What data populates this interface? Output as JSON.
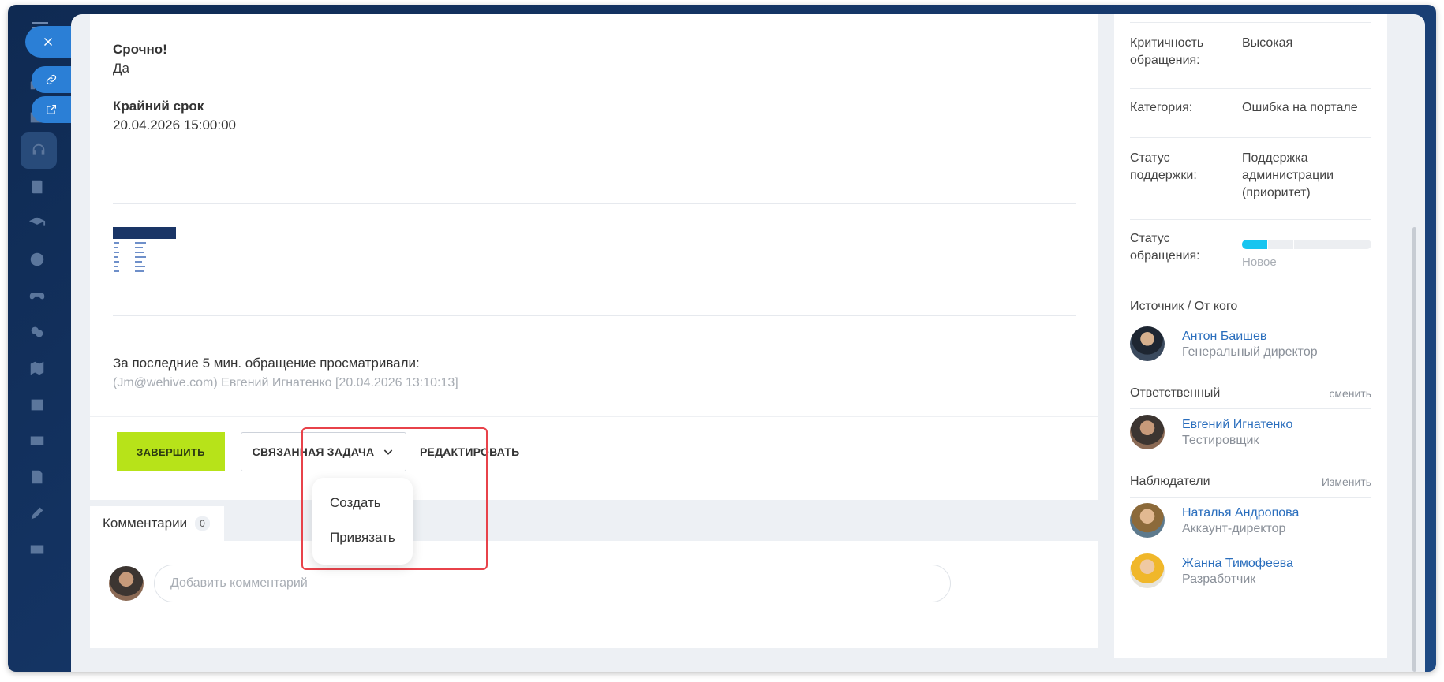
{
  "colors": {
    "accent_blue": "#2b7fd6",
    "finish_green": "#b7e319",
    "highlight_red": "#e8424a",
    "progress_cyan": "#17c5f0",
    "link_blue": "#2a6ebd"
  },
  "rail": {
    "icons": [
      "menu-icon",
      "close-icon",
      "link-icon",
      "external-link-icon",
      "home-icon",
      "support-icon",
      "book-icon",
      "graduation-cap-icon",
      "target-icon",
      "gamepad-icon",
      "chat-icon",
      "map-icon",
      "calendar-icon",
      "card-icon",
      "edit-doc-icon",
      "pen-icon",
      "id-card-icon"
    ]
  },
  "ticket": {
    "urgent_label": "Срочно!",
    "urgent_value": "Да",
    "deadline_label": "Крайний срок",
    "deadline_value": "20.04.2026 15:00:00",
    "viewed_title": "За последние 5 мин. обращение просматривали:",
    "viewed_list": "(Jm@wehive.com) Евгений Игнатенко [20.04.2026 13:10:13]"
  },
  "actions": {
    "finish_label": "ЗАВЕРШИТЬ",
    "related_task_label": "СВЯЗАННАЯ ЗАДАЧА",
    "edit_label": "РЕДАКТИРОВАТЬ",
    "dropdown_items": [
      "Создать",
      "Привязать"
    ]
  },
  "comments": {
    "tab_label": "Комментарии",
    "count": "0",
    "input_placeholder": "Добавить комментарий"
  },
  "sidebar": {
    "criticality_key": "Критичность обращения:",
    "criticality_value": "Высокая",
    "category_key": "Категория:",
    "category_value": "Ошибка на портале",
    "support_status_key": "Статус поддержки:",
    "support_status_value": "Поддержка администрации (приоритет)",
    "ticket_status_key": "Статус обращения:",
    "ticket_status_value": "Новое",
    "ticket_status_progress": 0.2,
    "source_title": "Источник / От кого",
    "source_person": {
      "name": "Антон Баишев",
      "role": "Генеральный директор"
    },
    "responsible_title": "Ответственный",
    "responsible_link": "сменить",
    "responsible_person": {
      "name": "Евгений Игнатенко",
      "role": "Тестировщик"
    },
    "watchers_title": "Наблюдатели",
    "watchers_link": "Изменить",
    "watchers": [
      {
        "name": "Наталья Андропова",
        "role": "Аккаунт-директор"
      },
      {
        "name": "Жанна Тимофеева",
        "role": "Разработчик"
      }
    ]
  }
}
